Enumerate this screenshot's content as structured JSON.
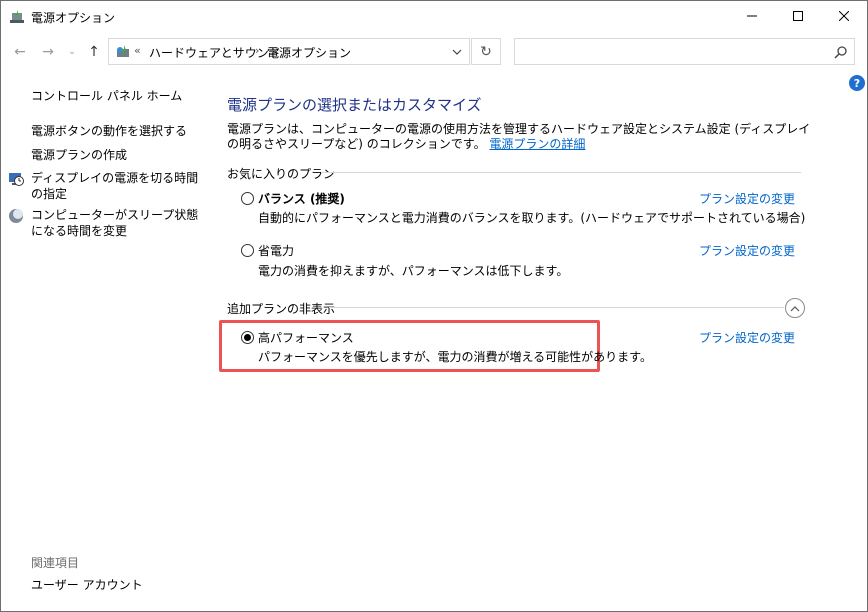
{
  "window": {
    "title": "電源オプション",
    "icon": "power-options-icon"
  },
  "titlebar_buttons": {
    "minimize": "minimize-icon",
    "maximize": "maximize-icon",
    "close": "close-icon"
  },
  "nav": {
    "back": "←",
    "forward": "→",
    "recent": "⌄",
    "up": "↑",
    "refresh": "↻"
  },
  "address": {
    "overflow": "«",
    "separator": "›",
    "crumbs": [
      "ハードウェアとサウンド",
      "電源オプション"
    ]
  },
  "search": {
    "placeholder": ""
  },
  "help": {
    "label": "?"
  },
  "sidebar": {
    "home": "コントロール パネル ホーム",
    "items": [
      "電源ボタンの動作を選択する",
      "電源プランの作成",
      "ディスプレイの電源を切る時間の指定",
      "コンピューターがスリープ状態になる時間を変更"
    ],
    "related_heading": "関連項目",
    "related_items": [
      "ユーザー アカウント"
    ]
  },
  "main": {
    "title": "電源プランの選択またはカスタマイズ",
    "description": "電源プランは、コンピューターの電源の使用方法を管理するハードウェア設定とシステム設定 (ディスプレイの明るさやスリープなど) のコレクションです。",
    "description_link": "電源プランの詳細",
    "favorites_heading": "お気に入りのプラン",
    "hidden_heading": "追加プランの非表示",
    "change_link": "プラン設定の変更",
    "plans": [
      {
        "name": "バランス (推奨)",
        "desc": "自動的にパフォーマンスと電力消費のバランスを取ります。(ハードウェアでサポートされている場合)",
        "selected": false
      },
      {
        "name": "省電力",
        "desc": "電力の消費を抑えますが、パフォーマンスは低下します。",
        "selected": false
      },
      {
        "name": "高パフォーマンス",
        "desc": "パフォーマンスを優先しますが、電力の消費が増える可能性があります。",
        "selected": true
      }
    ]
  },
  "colors": {
    "accent_title": "#1e3287",
    "link": "#0066cc",
    "highlight_border": "#ea5455"
  }
}
